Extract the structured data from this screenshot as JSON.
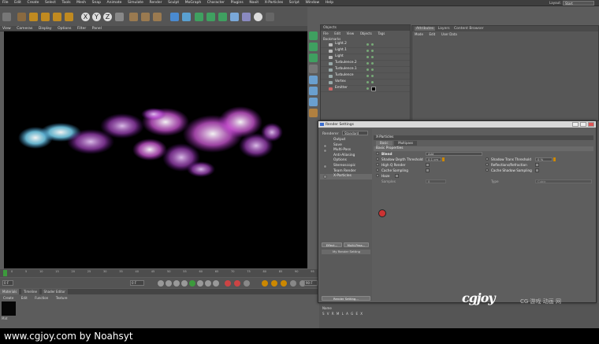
{
  "menubar": {
    "items": [
      "File",
      "Edit",
      "Create",
      "Select",
      "Tools",
      "Mesh",
      "Snap",
      "Animate",
      "Simulate",
      "Render",
      "Sculpt",
      "MoGraph",
      "Character",
      "Plugins",
      "Naxit",
      "X-Particles",
      "Script",
      "Window",
      "Help"
    ],
    "layout_label": "Layout:",
    "layout_value": "Start"
  },
  "toolbar": {
    "axis_buttons": [
      "X",
      "Y",
      "Z"
    ]
  },
  "viewport_menu": {
    "items": [
      "View",
      "Cameras",
      "Display",
      "Options",
      "Filter",
      "Panel"
    ]
  },
  "object_manager": {
    "header": "Objects",
    "menu": [
      "File",
      "Edit",
      "View",
      "Objects",
      "Tags",
      "Bookmarks"
    ],
    "objects": [
      "Light.2",
      "Light.1",
      "Light",
      "Turbulence.2",
      "Turbulence.1",
      "Turbulence",
      "Vortex",
      "Emitter"
    ]
  },
  "attributes": {
    "tabs": [
      "Attributes",
      "Layers",
      "Content Browser"
    ],
    "menu": [
      "Mode",
      "Edit",
      "User Data"
    ]
  },
  "timeline": {
    "ticks": [
      "0",
      "5",
      "10",
      "15",
      "20",
      "25",
      "30",
      "35",
      "40",
      "45",
      "50",
      "55",
      "60",
      "65",
      "70",
      "75",
      "80",
      "85",
      "90",
      "95"
    ],
    "start_frame": "0 F",
    "end_frame": "90 F"
  },
  "materials": {
    "tabs": [
      "Materials",
      "Timeline",
      "Shader Editor"
    ],
    "menu": [
      "Create",
      "Edit",
      "Function",
      "Texture"
    ],
    "material_name": "Mat"
  },
  "coordinates": {
    "name_label": "Name",
    "letters": "S V R M L A G E X"
  },
  "render_settings": {
    "title": "Render Settings",
    "renderer_label": "Renderer",
    "renderer_value": "Standard",
    "items": [
      "Output",
      "Save",
      "Multi-Pass",
      "Anti-Aliasing",
      "Options",
      "Stereoscopic",
      "Team Render",
      "X-Particles"
    ],
    "effect_button": "Effect...",
    "multipass_button": "Multi-Pass...",
    "my_render_setting": "My Render Setting",
    "render_setting_button": "Render Setting...",
    "xp": {
      "header": "X-Particles",
      "tabs": [
        "Basic",
        "Multipass"
      ],
      "section": "Basic Properties",
      "blend_label": "Blend",
      "blend_value": "Add",
      "shadow_depth_label": "Shadow Depth Threshold",
      "shadow_depth_value": "0.1 cm",
      "shadow_trans_label": "Shadow Trans Threshold",
      "shadow_trans_value": "0 %",
      "hq_label": "High Q Render",
      "refl_label": "Reflections/Refraction",
      "cache_label": "Cache Sampling",
      "cache_shadow_label": "Cache Shadow Sampling",
      "haze_label": "Haze",
      "samples_label": "Samples",
      "samples_value": "8",
      "type_label": "Type",
      "type_value": "Cubic"
    }
  },
  "watermark": {
    "logo": "cgjoy",
    "sub": "CG 游戏 动画 网"
  },
  "caption": "www.cgjoy.com by Noahsyt"
}
